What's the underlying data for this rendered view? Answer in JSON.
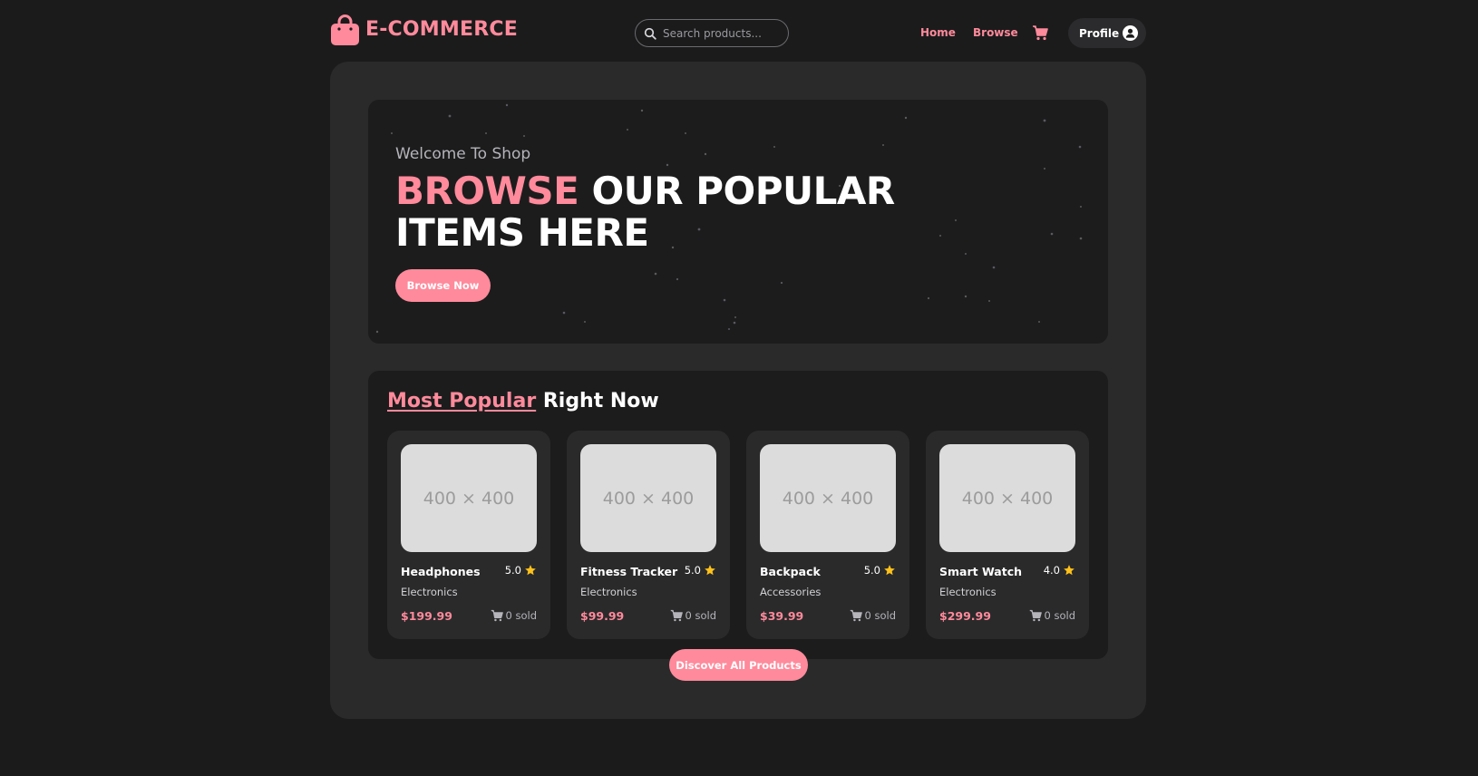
{
  "nav": {
    "logo_text": "E-COMMERCE",
    "search_placeholder": "Search products...",
    "links": [
      {
        "label": "Home"
      },
      {
        "label": "Browse"
      }
    ],
    "profile_label": "Profile"
  },
  "hero": {
    "welcome": "Welcome To Shop",
    "title_accent": "BROWSE",
    "title_rest": " OUR POPULAR ITEMS HERE",
    "button_label": "Browse Now"
  },
  "popular": {
    "heading_highlight": "Most Popular",
    "heading_rest": " Right Now",
    "products": [
      {
        "image_label": "400 × 400",
        "name": "Headphones",
        "rating": "5.0",
        "category": "Electronics",
        "price": "$199.99",
        "sold": "0 sold"
      },
      {
        "image_label": "400 × 400",
        "name": "Fitness Tracker",
        "rating": "5.0",
        "category": "Electronics",
        "price": "$99.99",
        "sold": "0 sold"
      },
      {
        "image_label": "400 × 400",
        "name": "Backpack",
        "rating": "5.0",
        "category": "Accessories",
        "price": "$39.99",
        "sold": "0 sold"
      },
      {
        "image_label": "400 × 400",
        "name": "Smart Watch",
        "rating": "4.0",
        "category": "Electronics",
        "price": "$299.99",
        "sold": "0 sold"
      }
    ],
    "discover_label": "Discover All Products"
  },
  "colors": {
    "accent": "#ff8a9b",
    "background": "#1b1b1c",
    "panel": "#2a2a2b",
    "card": "#2a2a2b",
    "inner": "#1c1c1d",
    "star": "#ffc21a"
  },
  "icons": {
    "logo": "shopping-bag-icon",
    "search": "search-icon",
    "cart": "cart-icon",
    "profile": "user-icon",
    "rating": "star-icon",
    "sold": "cart-icon"
  }
}
